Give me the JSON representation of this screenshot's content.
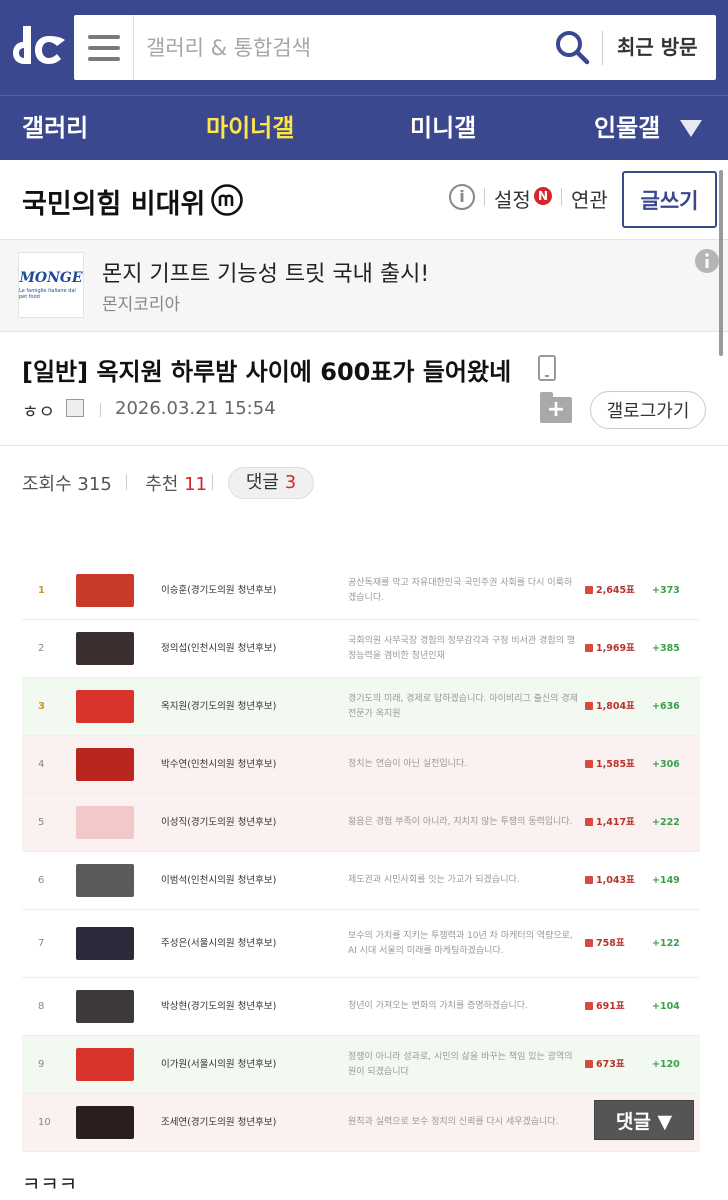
{
  "header": {
    "logo_icon": "dc-logo-icon",
    "search": {
      "placeholder": "갤러리 & 통합검색"
    },
    "recent_label": "최근 방문"
  },
  "nav": {
    "items": [
      {
        "label": "갤러리"
      },
      {
        "label": "마이너갤"
      },
      {
        "label": "미니갤"
      },
      {
        "label": "인물갤"
      }
    ],
    "active_index": 1
  },
  "gallery": {
    "title": "국민의힘 비대위",
    "badge_icon": "minor-gallery-m-icon",
    "settings_label": "설정",
    "new_badge": "N",
    "related_label": "연관",
    "write_label": "글쓰기"
  },
  "ad": {
    "logo_text": "MONGE",
    "logo_sub": "Le famiglie italiane dal pet food",
    "title": "몬지 기프트 기능성 트릿 국내 출시!",
    "sponsor": "몬지코리아"
  },
  "post": {
    "title": "[일반] 옥지원 하루밤 사이에 600표가 들어왔네",
    "author": "ㅎㅇ",
    "date": "2026.03.21 15:54",
    "gallog_label": "갤로그가기"
  },
  "stats": {
    "views_label": "조회수",
    "views": "315",
    "recommend_label": "추천",
    "recommend": "11",
    "comments_label": "댓글",
    "comments": "3"
  },
  "ranking": [
    {
      "rank": "1",
      "name": "이승훈(경기도의원 청년후보)",
      "pledge": "공산독재를 막고 자유대한민국 국민주권 사회를 다시 이룩하겠습니다.",
      "votes": "2,645표",
      "delta": "+373",
      "row": "white",
      "thumb": "#c93a2a"
    },
    {
      "rank": "2",
      "name": "정의섭(인천시의원 청년후보)",
      "pledge": "국회의원 사무국장 경험의 정무감각과 구청 비서관 경험의 행정능력을 겸비한 청년인재",
      "votes": "1,969표",
      "delta": "+385",
      "row": "white",
      "thumb": "#3a2e2e"
    },
    {
      "rank": "3",
      "name": "옥지원(경기도의원 청년후보)",
      "pledge": "경기도의 미래, 경제로 답하겠습니다. 아이비리그 출신의 경제전문가 옥지원",
      "votes": "1,804표",
      "delta": "+636",
      "row": "green",
      "thumb": "#d8342c"
    },
    {
      "rank": "4",
      "name": "박수연(인천시의원 청년후보)",
      "pledge": "정치는 연습이 아닌 실전입니다.",
      "votes": "1,585표",
      "delta": "+306",
      "row": "pink",
      "thumb": "#b8261f"
    },
    {
      "rank": "5",
      "name": "이성직(경기도의원 청년후보)",
      "pledge": "젊음은 경험 부족이 아니라, 지치지 않는 투쟁의 동력입니다.",
      "votes": "1,417표",
      "delta": "+222",
      "row": "pink",
      "thumb": "#f2c8c8"
    },
    {
      "rank": "6",
      "name": "이범석(인천시의원 청년후보)",
      "pledge": "제도권과 시민사회를 잇는 가교가 되겠습니다.",
      "votes": "1,043표",
      "delta": "+149",
      "row": "white",
      "thumb": "#5a5a5a"
    },
    {
      "rank": "7",
      "name": "주성은(서울시의원 청년후보)",
      "pledge": "보수의 가치를 지키는 투쟁력과 10년 차 마케터의 역량으로, AI 시대 서울의 미래를 마케팅하겠습니다.",
      "votes": "758표",
      "delta": "+122",
      "row": "white",
      "thumb": "#2a2a3a"
    },
    {
      "rank": "8",
      "name": "박상현(경기도의원 청년후보)",
      "pledge": "청년이 가져오는 변화의 가치를 증명하겠습니다.",
      "votes": "691표",
      "delta": "+104",
      "row": "white",
      "thumb": "#3e3a3a"
    },
    {
      "rank": "9",
      "name": "이가원(서울시의원 청년후보)",
      "pledge": "정쟁이 아니라 성과로, 시민의 삶을 바꾸는 책임 있는 광역의원이 되겠습니다",
      "votes": "673표",
      "delta": "+120",
      "row": "green",
      "thumb": "#d8342c"
    },
    {
      "rank": "10",
      "name": "조세연(경기도의원 청년후보)",
      "pledge": "원칙과 실력으로 보수 정치의 신뢰를 다시 세우겠습니다.",
      "votes": "",
      "delta": "",
      "row": "pink",
      "thumb": "#2a1e1e"
    }
  ],
  "comment_float": "댓글 ▼",
  "body_text": "ㅋㅋㅋ",
  "colors": {
    "brand": "#3b4890",
    "active_nav": "#ffe54a",
    "accent_red": "#d7262b",
    "delta_green": "#3aa04a"
  }
}
